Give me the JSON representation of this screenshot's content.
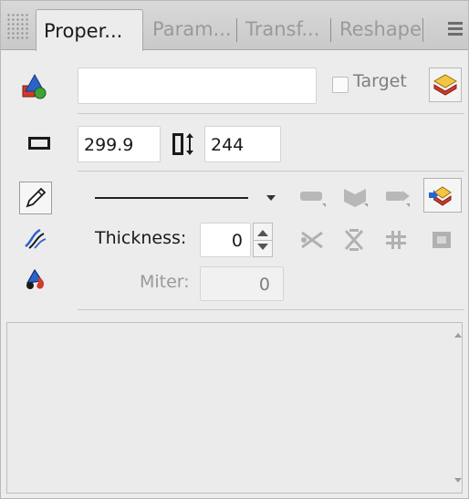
{
  "tabs": [
    {
      "label": "Proper...",
      "active": true
    },
    {
      "label": "Param...",
      "active": false
    },
    {
      "label": "Transf...",
      "active": false
    },
    {
      "label": "Reshape",
      "active": false
    }
  ],
  "object": {
    "name_value": "",
    "target_label": "Target",
    "target_checked": false
  },
  "size": {
    "width": "299.9",
    "height": "244"
  },
  "stroke": {
    "thickness_label": "Thickness:",
    "thickness_value": "0",
    "miter_label": "Miter:",
    "miter_value": "0"
  },
  "notes": {
    "value": ""
  },
  "icons": {
    "tab_grip": "grip-icon",
    "tab_menu": "panel-menu-icon",
    "object_type": "shapes-icon",
    "object_style": "style-layers-icon",
    "width": "width-icon",
    "height": "height-icon",
    "pen": "pen-tool-icon",
    "brush": "brush-tool-icon",
    "fill": "fill-tool-icon",
    "arrow_start": "arrow-start-icon",
    "arrow_middle": "arrow-middle-icon",
    "arrow_end": "arrow-end-icon",
    "line_style": "line-style-icon",
    "cap_1": "cap-style-icon",
    "cap_2": "join-style-icon",
    "cap_3": "grid-style-icon",
    "cap_4": "box-style-icon"
  },
  "colors": {
    "panel_bg": "#ececec",
    "tab_bg": "#d1d1d1",
    "accent_orange": "#e8a31f",
    "accent_blue": "#2b63c8",
    "accent_red": "#d23a2a",
    "accent_green": "#3fa436"
  }
}
